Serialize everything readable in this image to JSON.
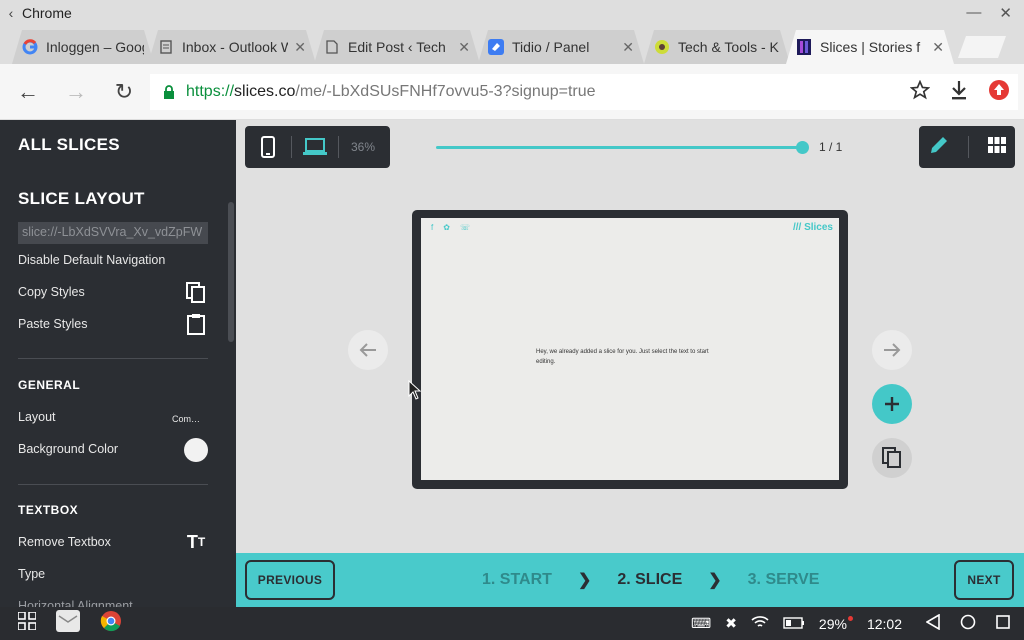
{
  "window": {
    "title": "Chrome"
  },
  "tabs": [
    {
      "label": "Inloggen – Google",
      "favicon": "google-icon"
    },
    {
      "label": "Inbox - Outlook W",
      "favicon": "document-icon"
    },
    {
      "label": "Edit Post ‹ Tech",
      "favicon": "document-icon"
    },
    {
      "label": "Tidio / Panel",
      "favicon": "tidio-icon"
    },
    {
      "label": "Tech & Tools - K",
      "favicon": "techtools-icon"
    },
    {
      "label": "Slices | Stories f",
      "favicon": "slices-icon",
      "active": true
    }
  ],
  "address": {
    "scheme": "https://",
    "host": "slices.co",
    "path": "/me/-LbXdSUsFNHf7ovvu5-3?signup=true"
  },
  "sidebar": {
    "all_slices": "ALL SLICES",
    "slice_layout": "SLICE LAYOUT",
    "slice_url": "slice://-LbXdSVVra_Xv_vdZpFW",
    "disable_nav": "Disable Default Navigation",
    "copy_styles": "Copy Styles",
    "paste_styles": "Paste Styles",
    "general": "GENERAL",
    "layout_label": "Layout",
    "layout_value": "Com…",
    "bg_color_label": "Background Color",
    "textbox": "TEXTBOX",
    "remove_textbox": "Remove Textbox",
    "type_label": "Type",
    "h_align_label": "Horizontal Alignment"
  },
  "editor": {
    "zoom": "36%",
    "page_count": "1 / 1",
    "page_progress": 1.0,
    "preview": {
      "brand": "/// Slices",
      "message": "Hey, we already added a slice for you. Just select the text to start editing."
    }
  },
  "footer": {
    "previous": "PREVIOUS",
    "next": "NEXT",
    "steps": [
      "1. START",
      "2. SLICE",
      "3. SERVE"
    ],
    "current_step": 1
  },
  "system": {
    "battery": "29%",
    "time": "12:02"
  },
  "colors": {
    "accent": "#49cacb",
    "sidebar_bg": "#2b2e33"
  }
}
